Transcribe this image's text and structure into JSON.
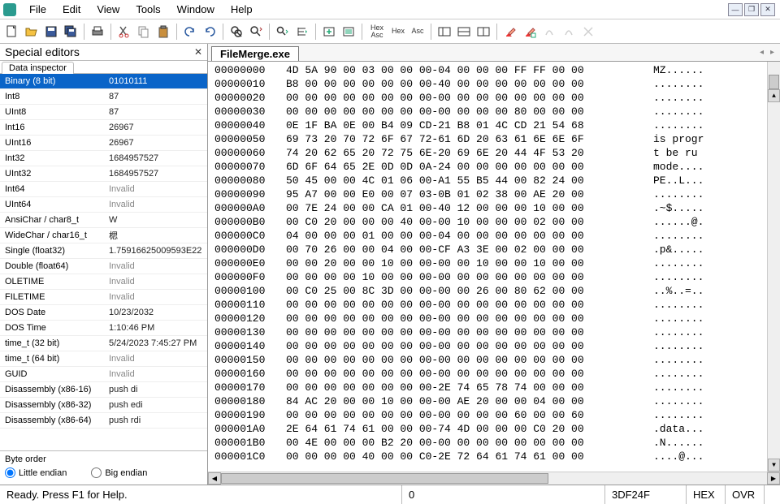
{
  "menu": [
    "File",
    "Edit",
    "View",
    "Tools",
    "Window",
    "Help"
  ],
  "panel": {
    "title": "Special editors",
    "subtab": "Data inspector",
    "rows": [
      {
        "k": "Binary (8 bit)",
        "v": "01010111",
        "sel": true
      },
      {
        "k": "Int8",
        "v": "87"
      },
      {
        "k": "UInt8",
        "v": "87"
      },
      {
        "k": "Int16",
        "v": "26967"
      },
      {
        "k": "UInt16",
        "v": "26967"
      },
      {
        "k": "Int32",
        "v": "1684957527"
      },
      {
        "k": "UInt32",
        "v": "1684957527"
      },
      {
        "k": "Int64",
        "v": "Invalid",
        "grey": true
      },
      {
        "k": "UInt64",
        "v": "Invalid",
        "grey": true
      },
      {
        "k": "AnsiChar / char8_t",
        "v": "W"
      },
      {
        "k": "WideChar / char16_t",
        "v": "楒"
      },
      {
        "k": "Single (float32)",
        "v": "1.75916625009593E22"
      },
      {
        "k": "Double (float64)",
        "v": "Invalid",
        "grey": true
      },
      {
        "k": "OLETIME",
        "v": "Invalid",
        "grey": true
      },
      {
        "k": "FILETIME",
        "v": "Invalid",
        "grey": true
      },
      {
        "k": "DOS Date",
        "v": "10/23/2032"
      },
      {
        "k": "DOS Time",
        "v": "1:10:46 PM"
      },
      {
        "k": "time_t (32 bit)",
        "v": "5/24/2023 7:45:27 PM"
      },
      {
        "k": "time_t (64 bit)",
        "v": "Invalid",
        "grey": true
      },
      {
        "k": "GUID",
        "v": "Invalid",
        "grey": true
      },
      {
        "k": "Disassembly (x86-16)",
        "v": "push di"
      },
      {
        "k": "Disassembly (x86-32)",
        "v": "push edi"
      },
      {
        "k": "Disassembly (x86-64)",
        "v": "push rdi"
      }
    ],
    "byte_order_label": "Byte order",
    "little": "Little endian",
    "big": "Big endian"
  },
  "file_tab": "FileMerge.exe",
  "hex": [
    {
      "o": "00000000",
      "b": "4D 5A 90 00 03 00 00 00-04 00 00 00 FF FF 00 00",
      "a": "MZ......"
    },
    {
      "o": "00000010",
      "b": "B8 00 00 00 00 00 00 00-40 00 00 00 00 00 00 00",
      "a": "........"
    },
    {
      "o": "00000020",
      "b": "00 00 00 00 00 00 00 00-00 00 00 00 00 00 00 00",
      "a": "........"
    },
    {
      "o": "00000030",
      "b": "00 00 00 00 00 00 00 00-00 00 00 00 80 00 00 00",
      "a": "........"
    },
    {
      "o": "00000040",
      "b": "0E 1F BA 0E 00 B4 09 CD-21 B8 01 4C CD 21 54 68",
      "a": "........"
    },
    {
      "o": "00000050",
      "b": "69 73 20 70 72 6F 67 72-61 6D 20 63 61 6E 6E 6F",
      "a": "is progr"
    },
    {
      "o": "00000060",
      "b": "74 20 62 65 20 72 75 6E-20 69 6E 20 44 4F 53 20",
      "a": "t be ru "
    },
    {
      "o": "00000070",
      "b": "6D 6F 64 65 2E 0D 0D 0A-24 00 00 00 00 00 00 00",
      "a": "mode...."
    },
    {
      "o": "00000080",
      "b": "50 45 00 00 4C 01 06 00-A1 55 B5 44 00 82 24 00",
      "a": "PE..L..."
    },
    {
      "o": "00000090",
      "b": "95 A7 00 00 E0 00 07 03-0B 01 02 38 00 AE 20 00",
      "a": "........"
    },
    {
      "o": "000000A0",
      "b": "00 7E 24 00 00 CA 01 00-40 12 00 00 00 10 00 00",
      "a": ".~$....."
    },
    {
      "o": "000000B0",
      "b": "00 C0 20 00 00 00 40 00-00 10 00 00 00 02 00 00",
      "a": "......@."
    },
    {
      "o": "000000C0",
      "b": "04 00 00 00 01 00 00 00-04 00 00 00 00 00 00 00",
      "a": "........"
    },
    {
      "o": "000000D0",
      "b": "00 70 26 00 00 04 00 00-CF A3 3E 00 02 00 00 00",
      "a": ".p&....."
    },
    {
      "o": "000000E0",
      "b": "00 00 20 00 00 10 00 00-00 00 10 00 00 10 00 00",
      "a": "........"
    },
    {
      "o": "000000F0",
      "b": "00 00 00 00 10 00 00 00-00 00 00 00 00 00 00 00",
      "a": "........"
    },
    {
      "o": "00000100",
      "b": "00 C0 25 00 8C 3D 00 00-00 00 26 00 80 62 00 00",
      "a": "..%..=.."
    },
    {
      "o": "00000110",
      "b": "00 00 00 00 00 00 00 00-00 00 00 00 00 00 00 00",
      "a": "........"
    },
    {
      "o": "00000120",
      "b": "00 00 00 00 00 00 00 00-00 00 00 00 00 00 00 00",
      "a": "........"
    },
    {
      "o": "00000130",
      "b": "00 00 00 00 00 00 00 00-00 00 00 00 00 00 00 00",
      "a": "........"
    },
    {
      "o": "00000140",
      "b": "00 00 00 00 00 00 00 00-00 00 00 00 00 00 00 00",
      "a": "........"
    },
    {
      "o": "00000150",
      "b": "00 00 00 00 00 00 00 00-00 00 00 00 00 00 00 00",
      "a": "........"
    },
    {
      "o": "00000160",
      "b": "00 00 00 00 00 00 00 00-00 00 00 00 00 00 00 00",
      "a": "........"
    },
    {
      "o": "00000170",
      "b": "00 00 00 00 00 00 00 00-2E 74 65 78 74 00 00 00",
      "a": "........"
    },
    {
      "o": "00000180",
      "b": "84 AC 20 00 00 10 00 00-00 AE 20 00 00 04 00 00",
      "a": "........"
    },
    {
      "o": "00000190",
      "b": "00 00 00 00 00 00 00 00-00 00 00 00 60 00 00 60",
      "a": "........"
    },
    {
      "o": "000001A0",
      "b": "2E 64 61 74 61 00 00 00-74 4D 00 00 00 C0 20 00",
      "a": ".data..."
    },
    {
      "o": "000001B0",
      "b": "00 4E 00 00 00 B2 20 00-00 00 00 00 00 00 00 00",
      "a": ".N......"
    },
    {
      "o": "000001C0",
      "b": "00 00 00 00 40 00 00 C0-2E 72 64 61 74 61 00 00",
      "a": "....@..."
    }
  ],
  "status": {
    "ready": "Ready.  Press F1 for Help.",
    "pos": "0",
    "size": "3DF24F",
    "hex": "HEX",
    "ovr": "OVR"
  },
  "toolbar_text": {
    "hexasc": "Hex\nAsc",
    "hex": "Hex",
    "asc": "Asc"
  }
}
